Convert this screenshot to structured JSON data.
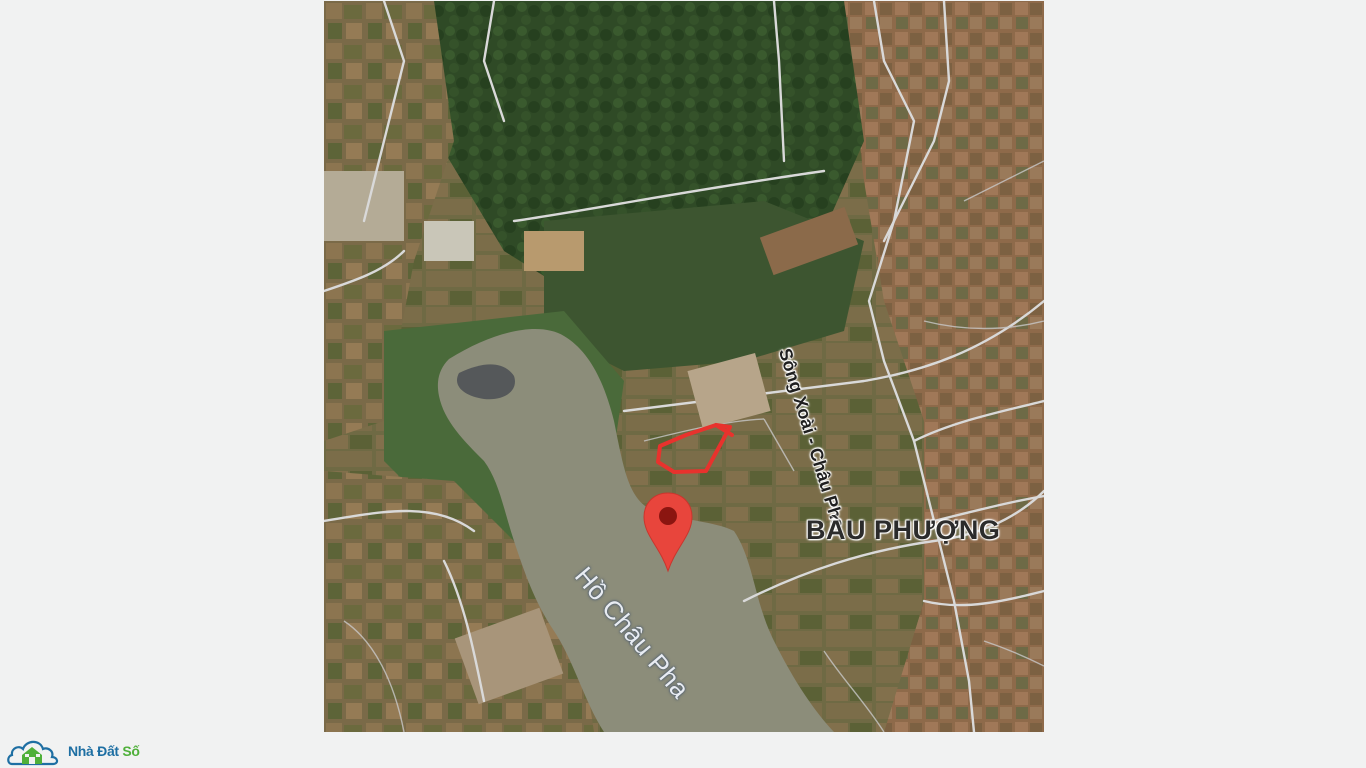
{
  "map": {
    "area_label": "BÀU PHƯỢNG",
    "road_label": "Sông Xoài - Châu Pha",
    "lake_label": "Hồ Châu Pha",
    "marker": "red-location-pin",
    "parcel_outline_color": "#e8322d",
    "pin_color": "#e8453c"
  },
  "watermark": {
    "brand_part1": "Nhà Đất ",
    "brand_part2": "Số",
    "icon": "house-cloud-icon",
    "color_primary": "#1e6fa3",
    "color_accent": "#4fb03a"
  }
}
